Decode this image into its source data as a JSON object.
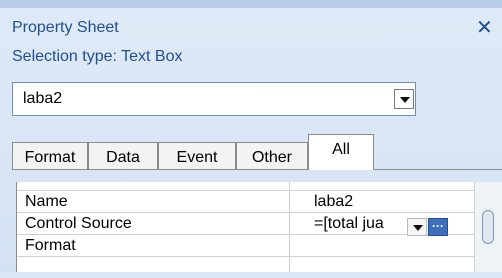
{
  "pane": {
    "title": "Property Sheet",
    "selection_type": "Selection type:  Text Box"
  },
  "selector": {
    "value": "laba2"
  },
  "tabs": [
    {
      "label": "Format"
    },
    {
      "label": "Data"
    },
    {
      "label": "Event"
    },
    {
      "label": "Other"
    },
    {
      "label": "All",
      "active": true
    }
  ],
  "properties": [
    {
      "name": "Name",
      "value": "laba2"
    },
    {
      "name": "Control Source",
      "value": "=[total jua"
    },
    {
      "name": "Format",
      "value": ""
    }
  ],
  "icons": {
    "close": "close-icon",
    "dropdown": "chevron-down-icon",
    "builder": "ellipsis-icon"
  }
}
